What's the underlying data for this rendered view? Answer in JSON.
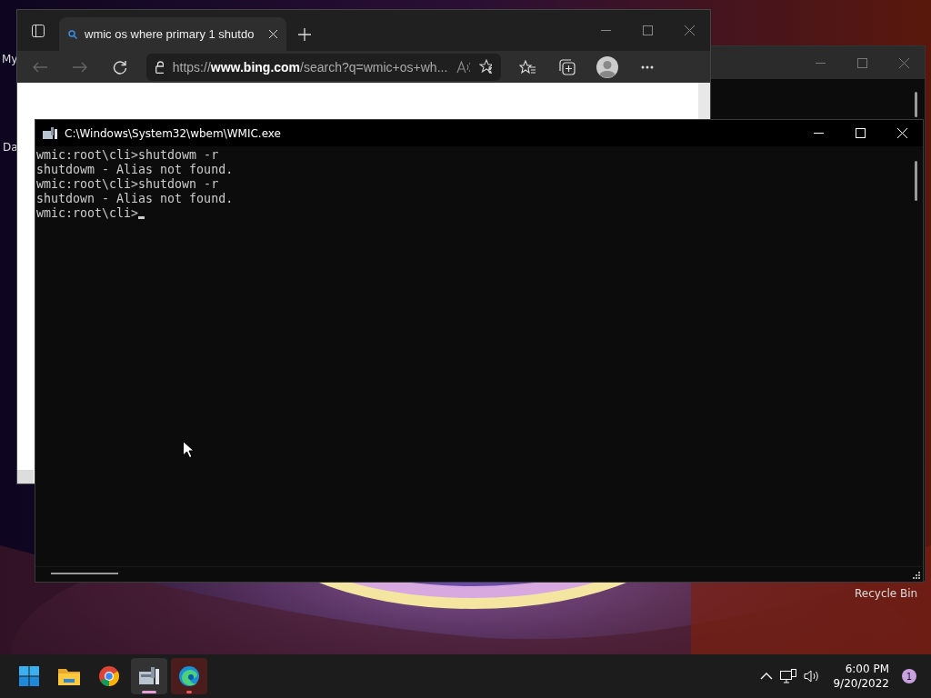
{
  "desktop_icons": [
    {
      "label": "My"
    },
    {
      "label": "Da"
    },
    {
      "label": "Recycle Bin"
    }
  ],
  "browser": {
    "tab": {
      "title": "wmic os where primary 1 shutdo"
    },
    "address": "https://**www.bing.com**/search?q=wmic+os+wh..."
  },
  "console": {
    "title": "C:\\Windows\\System32\\wbem\\WMIC.exe",
    "lines": [
      "wmic:root\\cli>shutdowm -r",
      "shutdowm - Alias not found.",
      "wmic:root\\cli>shutdown -r",
      "shutdown - Alias not found.",
      "wmic:root\\cli>"
    ]
  },
  "taskbar": {
    "apps": [
      {
        "kind": "start",
        "selected": false,
        "attention": false
      },
      {
        "kind": "folder",
        "selected": false,
        "attention": false
      },
      {
        "kind": "chrome",
        "selected": false,
        "attention": false
      },
      {
        "kind": "console",
        "selected": true,
        "attention": false
      },
      {
        "kind": "edge",
        "selected": false,
        "attention": true
      }
    ],
    "time": "6:00 PM",
    "date": "9/20/2022",
    "notifications": "1"
  }
}
